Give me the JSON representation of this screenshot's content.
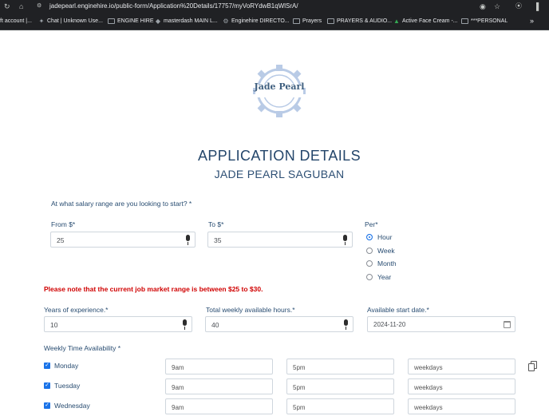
{
  "browser": {
    "url": "jadepearl.enginehire.io/public-form/Application%20Details/17757/myVoRYdwB1qWlSrA/",
    "bookmarks": [
      "ft account |...",
      "Chat | Unknown Use...",
      "ENGINE HIRE",
      "masterdash MAIN L...",
      "Enginehire DIRECTO...",
      "Prayers",
      "PRAYERS & AUDIO...",
      "Active Face Cream -...",
      "***PERSONAL"
    ],
    "more_bookmarks": "»"
  },
  "logo": {
    "text": "Jade Pearl"
  },
  "form": {
    "title": "APPLICATION DETAILS",
    "applicant_name": "JADE PEARL SAGUBAN",
    "salary_question": "At what salary range are you looking to start? *",
    "from_label": "From $*",
    "from_value": "25",
    "to_label": "To $*",
    "to_value": "35",
    "per_label": "Per*",
    "per_options": [
      "Hour",
      "Week",
      "Month",
      "Year"
    ],
    "per_selected": "Hour",
    "notice": "Please note that the current job market range is between $25 to $30.",
    "experience_label": "Years of experience.*",
    "experience_value": "10",
    "hours_label": "Total weekly available hours.*",
    "hours_value": "40",
    "start_label": "Available start date.*",
    "start_value": "2024-11-20",
    "availability_label": "Weekly Time Availability *",
    "availability": [
      {
        "day": "Monday",
        "checked": true,
        "from": "9am",
        "to": "5pm",
        "days": "weekdays"
      },
      {
        "day": "Tuesday",
        "checked": true,
        "from": "9am",
        "to": "5pm",
        "days": "weekdays"
      },
      {
        "day": "Wednesday",
        "checked": true,
        "from": "9am",
        "to": "5pm",
        "days": "weekdays"
      }
    ]
  },
  "colors": {
    "heading": "#24466b",
    "notice": "#d00000",
    "accent": "#1a73e8"
  }
}
